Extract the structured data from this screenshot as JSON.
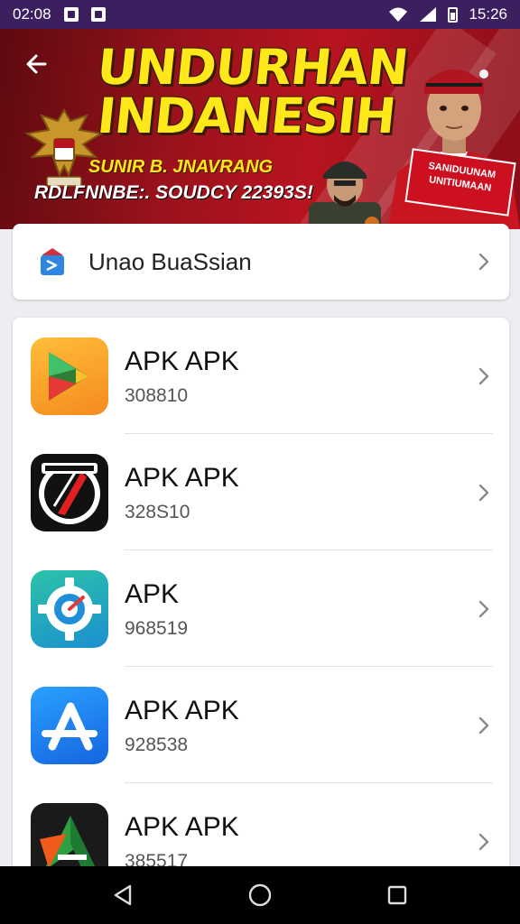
{
  "status_bar": {
    "time_left": "02:08",
    "time_right": "15:26",
    "icons": [
      "notification-icon",
      "notification-icon-2",
      "wifi-icon",
      "signal-icon",
      "battery-icon"
    ]
  },
  "banner": {
    "title_line1": "UNDURHAN",
    "title_line2": "INDANESIH",
    "subtitle": "SUNIR B. JNAVRANG",
    "subtitle2": "RDLFNNBE:. SOUDCY 22393S!",
    "sign_text": "SANIDUUNAM UNITIUMAAN"
  },
  "info_card": {
    "label": "Unao BuaSsian"
  },
  "apps": [
    {
      "name": "APK APK",
      "number": "308810",
      "icon": "play-store-icon"
    },
    {
      "name": "APK APK",
      "number": "328S10",
      "icon": "racing-logo-icon"
    },
    {
      "name": "APK",
      "number": "968519",
      "icon": "settings-gear-icon"
    },
    {
      "name": "APK APK",
      "number": "928538",
      "icon": "app-store-icon"
    },
    {
      "name": "APK APK",
      "number": "385517",
      "icon": "arrow-a-icon"
    }
  ],
  "colors": {
    "status_bar_bg": "#3b1f5e",
    "banner_red": "#b7141f",
    "title_yellow": "#ffe81a",
    "nav_bg": "#000000"
  }
}
